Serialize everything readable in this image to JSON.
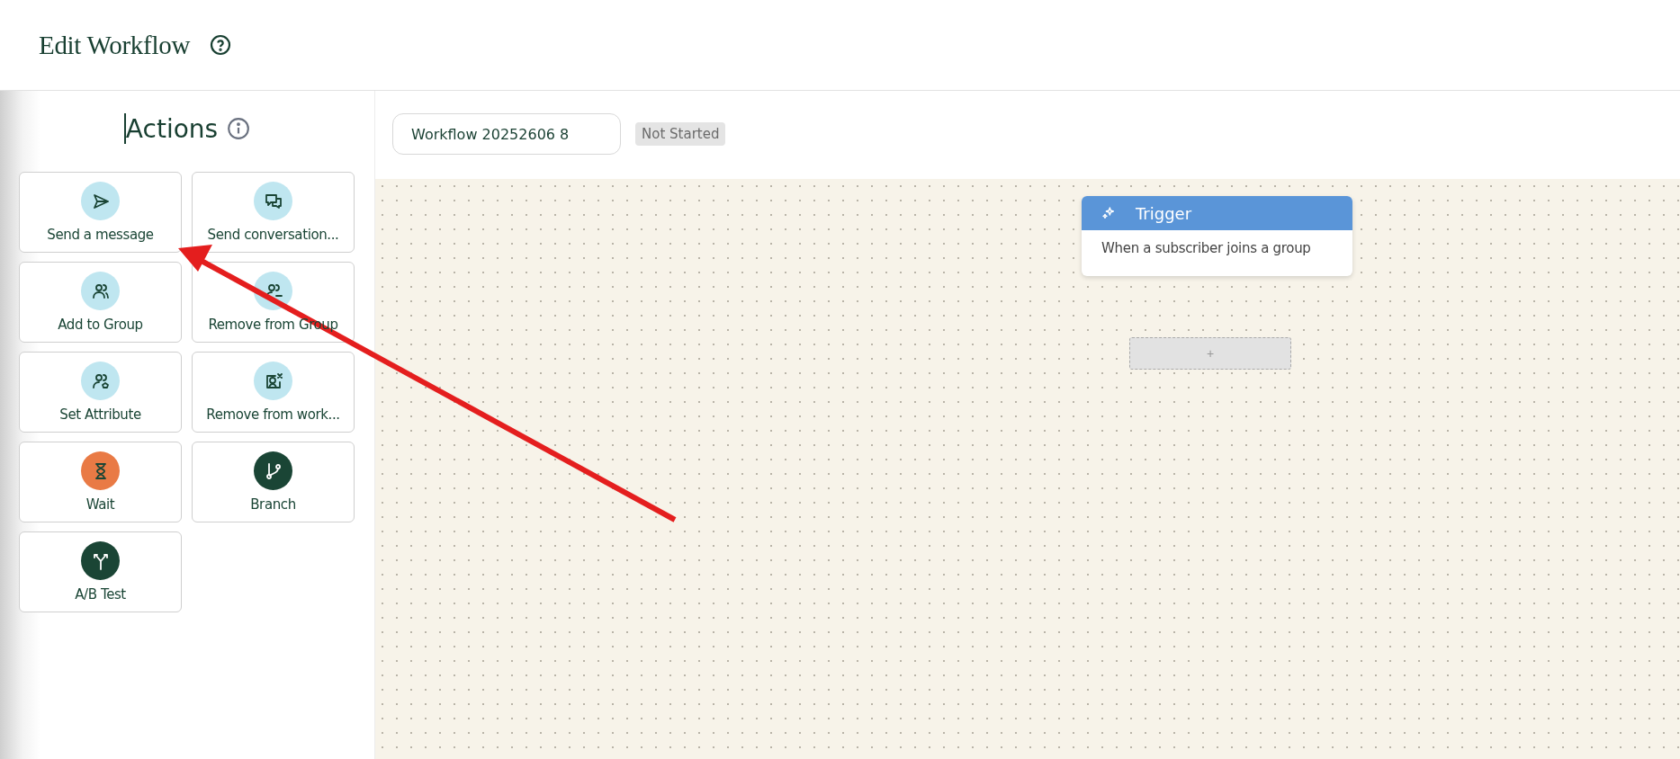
{
  "header": {
    "title": "Edit Workflow"
  },
  "sidebar": {
    "title": "Actions",
    "actions": [
      {
        "label": "Send a message",
        "color": "#bfe6f0"
      },
      {
        "label": "Send conversation...",
        "color": "#bfe6f0"
      },
      {
        "label": "Add to Group",
        "color": "#bfe6f0"
      },
      {
        "label": "Remove from Group",
        "color": "#bfe6f0"
      },
      {
        "label": "Set Attribute",
        "color": "#bfe6f0"
      },
      {
        "label": "Remove from work...",
        "color": "#bfe6f0"
      },
      {
        "label": "Wait",
        "color": "#e97a45"
      },
      {
        "label": "Branch",
        "color": "#1a4535"
      },
      {
        "label": "A/B Test",
        "color": "#1a4535"
      }
    ]
  },
  "workflow": {
    "name": "Workflow 20252606 8",
    "status": "Not Started"
  },
  "canvas": {
    "trigger": {
      "title": "Trigger",
      "description": "When a subscriber joins a group"
    },
    "add_button": "+"
  }
}
